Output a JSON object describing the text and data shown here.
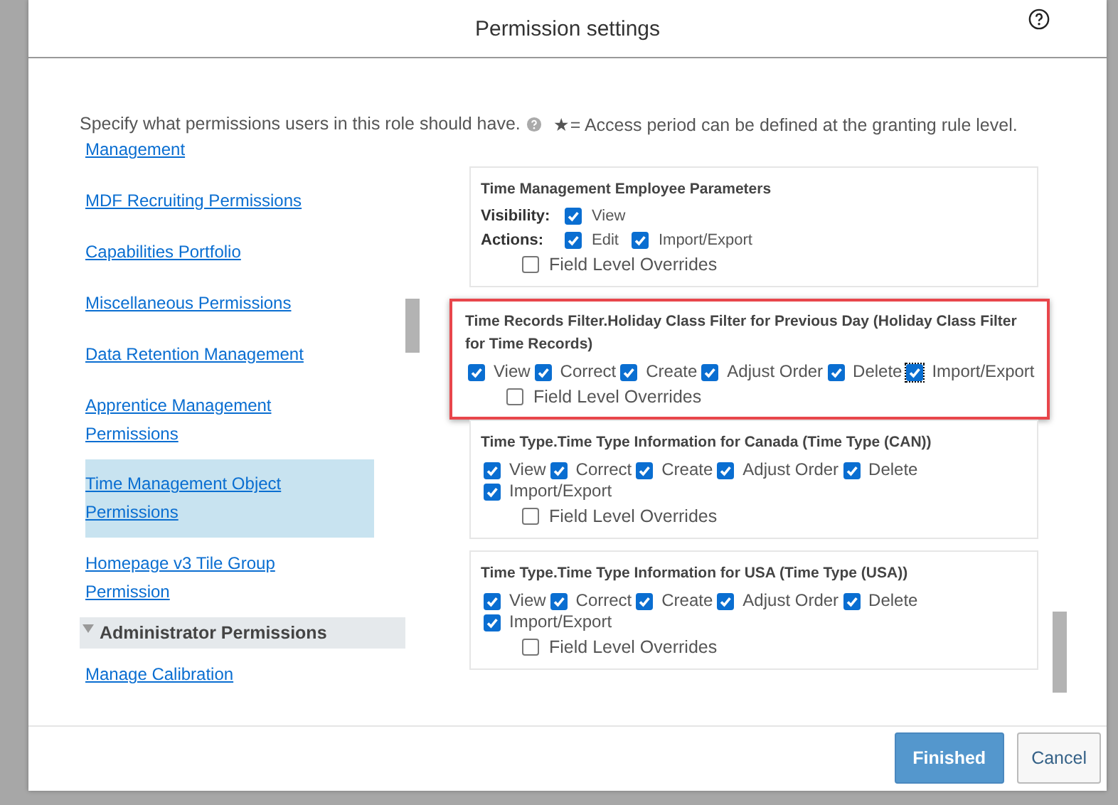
{
  "dialog": {
    "title": "Permission settings"
  },
  "intro": {
    "text": "Specify what permissions users in this role should have.",
    "note": "★= Access period can be defined at the granting rule level."
  },
  "sidebar": {
    "items": [
      {
        "kind": "link",
        "label": "Management",
        "selected": false
      },
      {
        "kind": "link",
        "label": "MDF Recruiting Permissions",
        "selected": false
      },
      {
        "kind": "link",
        "label": "Capabilities Portfolio",
        "selected": false
      },
      {
        "kind": "link",
        "label": "Miscellaneous Permissions",
        "selected": false
      },
      {
        "kind": "link",
        "label": "Data Retention Management",
        "selected": false
      },
      {
        "kind": "link",
        "label": "Apprentice Management Permissions",
        "selected": false
      },
      {
        "kind": "link",
        "label": "Time Management Object Permissions",
        "selected": true
      },
      {
        "kind": "link",
        "label": "Homepage v3 Tile Group Permission",
        "selected": false
      },
      {
        "kind": "section",
        "label": "Administrator Permissions",
        "expanded": true
      },
      {
        "kind": "link",
        "label": "Manage Calibration",
        "selected": false
      }
    ]
  },
  "cards": [
    {
      "kind": "grouped",
      "title": "Time Management Employee Parameters",
      "highlighted": false,
      "groups": [
        {
          "label": "Visibility:",
          "options": [
            {
              "label": "View",
              "checked": true,
              "focused": false
            }
          ]
        },
        {
          "label": "Actions:",
          "options": [
            {
              "label": "Edit",
              "checked": true,
              "focused": false
            },
            {
              "label": "Import/Export",
              "checked": true,
              "focused": false
            }
          ]
        }
      ],
      "field_level_overrides": {
        "label": "Field Level Overrides",
        "checked": false
      }
    },
    {
      "kind": "flat",
      "title": "Time Records Filter.Holiday Class Filter for Previous Day (Holiday Class Filter for Time Records)",
      "highlighted": true,
      "options": [
        {
          "label": "View",
          "checked": true,
          "focused": false
        },
        {
          "label": "Correct",
          "checked": true,
          "focused": false
        },
        {
          "label": "Create",
          "checked": true,
          "focused": false
        },
        {
          "label": "Adjust Order",
          "checked": true,
          "focused": false
        },
        {
          "label": "Delete",
          "checked": true,
          "focused": false
        },
        {
          "label": "Import/Export",
          "checked": true,
          "focused": true
        }
      ],
      "field_level_overrides": {
        "label": "Field Level Overrides",
        "checked": false
      }
    },
    {
      "kind": "flat",
      "title": "Time Type.Time Type Information for Canada (Time Type (CAN))",
      "highlighted": false,
      "options": [
        {
          "label": "View",
          "checked": true,
          "focused": false
        },
        {
          "label": "Correct",
          "checked": true,
          "focused": false
        },
        {
          "label": "Create",
          "checked": true,
          "focused": false
        },
        {
          "label": "Adjust Order",
          "checked": true,
          "focused": false
        },
        {
          "label": "Delete",
          "checked": true,
          "focused": false
        },
        {
          "label": "Import/Export",
          "checked": true,
          "focused": false
        }
      ],
      "field_level_overrides": {
        "label": "Field Level Overrides",
        "checked": false
      }
    },
    {
      "kind": "flat",
      "title": "Time Type.Time Type Information for USA (Time Type (USA))",
      "highlighted": false,
      "options": [
        {
          "label": "View",
          "checked": true,
          "focused": false
        },
        {
          "label": "Correct",
          "checked": true,
          "focused": false
        },
        {
          "label": "Create",
          "checked": true,
          "focused": false
        },
        {
          "label": "Adjust Order",
          "checked": true,
          "focused": false
        },
        {
          "label": "Delete",
          "checked": true,
          "focused": false
        },
        {
          "label": "Import/Export",
          "checked": true,
          "focused": false
        }
      ],
      "field_level_overrides": {
        "label": "Field Level Overrides",
        "checked": false
      }
    }
  ],
  "buttons": [
    {
      "label": "Finished",
      "kind": "primary"
    },
    {
      "label": "Cancel",
      "kind": "secondary"
    }
  ]
}
